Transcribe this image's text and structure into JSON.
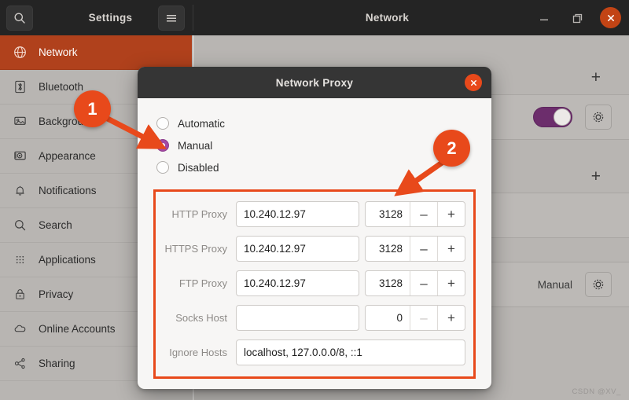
{
  "window": {
    "app_title": "Settings",
    "panel_title": "Network",
    "search_icon": "search-icon",
    "menu_icon": "hamburger-menu-icon",
    "minimize_label": "–",
    "maximize_label": "restore-icon",
    "close_label": "×"
  },
  "sidebar": {
    "items": [
      {
        "label": "Network",
        "icon": "globe-icon",
        "active": true
      },
      {
        "label": "Bluetooth",
        "icon": "bluetooth-icon",
        "active": false
      },
      {
        "label": "Background",
        "icon": "monitor-icon",
        "active": false
      },
      {
        "label": "Appearance",
        "icon": "appearance-icon",
        "active": false
      },
      {
        "label": "Notifications",
        "icon": "bell-icon",
        "active": false
      },
      {
        "label": "Search",
        "icon": "search-icon",
        "active": false
      },
      {
        "label": "Applications",
        "icon": "grid-icon",
        "active": false
      },
      {
        "label": "Privacy",
        "icon": "lock-icon",
        "active": false
      },
      {
        "label": "Online Accounts",
        "icon": "cloud-icon",
        "active": false
      },
      {
        "label": "Sharing",
        "icon": "share-icon",
        "active": false
      }
    ]
  },
  "network_panel": {
    "add_button_label": "+",
    "add_button_label_2": "+",
    "vpn_toggle_state": "on",
    "gear_icon": "gear-icon",
    "proxy_value": "Manual",
    "proxy_gear_icon": "gear-icon"
  },
  "dialog": {
    "title": "Network Proxy",
    "close_label": "×",
    "method_options": [
      {
        "label": "Automatic",
        "selected": false
      },
      {
        "label": "Manual",
        "selected": true
      },
      {
        "label": "Disabled",
        "selected": false
      }
    ],
    "fields": [
      {
        "label": "HTTP Proxy",
        "host": "10.240.12.97",
        "port": "3128",
        "minus": "–",
        "plus": "+",
        "minus_dim": false
      },
      {
        "label": "HTTPS Proxy",
        "host": "10.240.12.97",
        "port": "3128",
        "minus": "–",
        "plus": "+",
        "minus_dim": false
      },
      {
        "label": "FTP Proxy",
        "host": "10.240.12.97",
        "port": "3128",
        "minus": "–",
        "plus": "+",
        "minus_dim": false
      },
      {
        "label": "Socks Host",
        "host": "",
        "port": "0",
        "minus": "–",
        "plus": "+",
        "minus_dim": true
      }
    ],
    "ignore_hosts": {
      "label": "Ignore Hosts",
      "value": "localhost, 127.0.0.0/8, ::1"
    }
  },
  "callouts": [
    {
      "number": "1"
    },
    {
      "number": "2"
    }
  ],
  "watermark": "CSDN @XV_",
  "colors": {
    "accent_orange": "#e8491b",
    "sidebar_active": "#b0411c",
    "radio_purple": "#a347a3",
    "toggle_purple": "#6c2d6c",
    "titlebar": "#242424"
  }
}
